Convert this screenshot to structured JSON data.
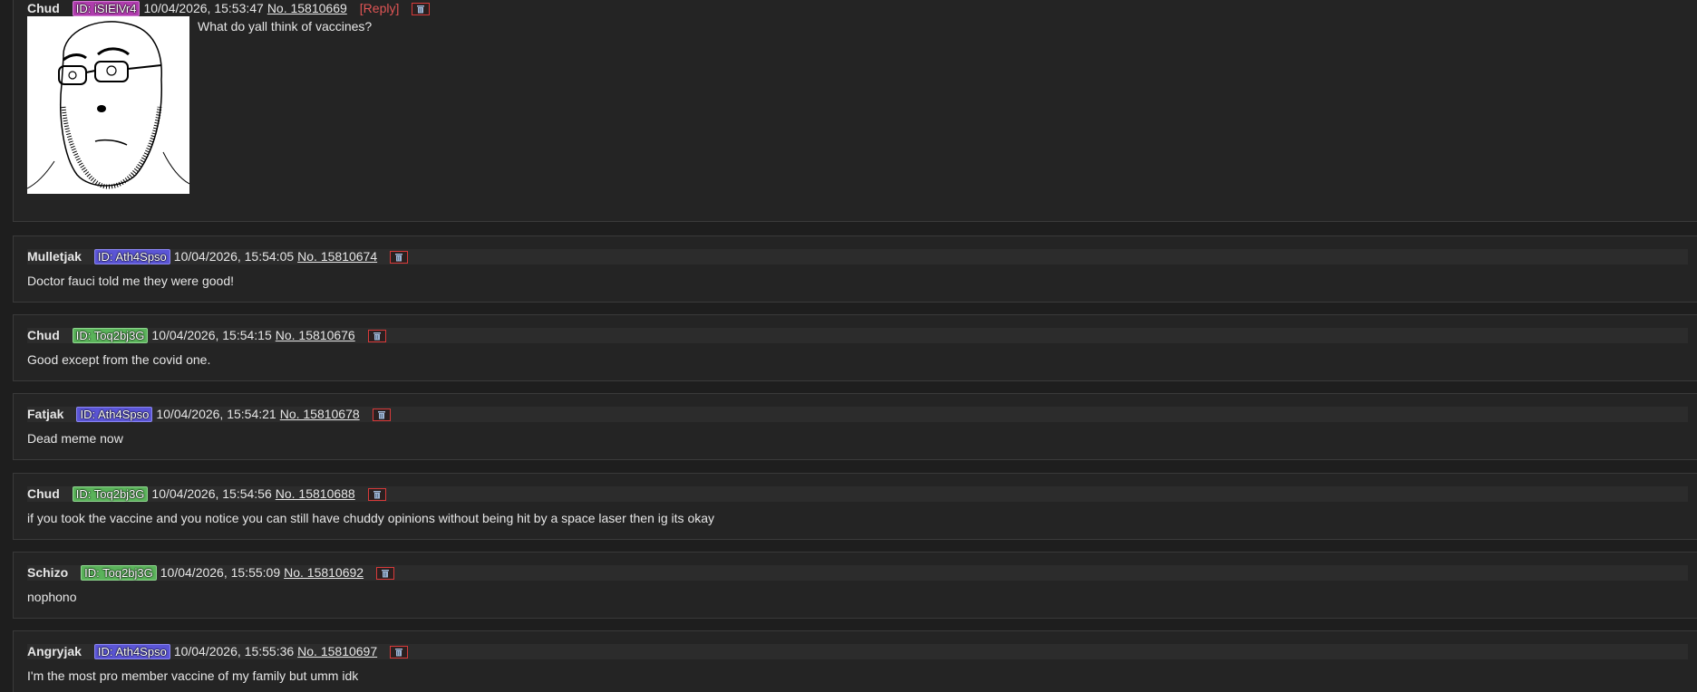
{
  "colors": {
    "background": "#1e1e1e",
    "post_background": "#242424",
    "id_purple": "#5b55d6",
    "id_green": "#5ab35a",
    "id_magenta": "#b03dae",
    "reply_link": "#e05555",
    "delete_border": "#d83a3a"
  },
  "op": {
    "name": "Chud",
    "id": "ID: iSIElVr4",
    "timestamp": "10/04/2026, 15:53:47",
    "post_no": "No. 15810669",
    "reply_label": "[Reply]",
    "delete_icon": "trash-icon",
    "image": "wojak-glasses-beard-drawing",
    "text": "What do yall think of vaccines?"
  },
  "replies": [
    {
      "name": "Mulletjak",
      "id": "ID: Ath4Spso",
      "timestamp": "10/04/2026, 15:54:05",
      "post_no": "No. 15810674",
      "text": "Doctor fauci told me they were good!"
    },
    {
      "name": "Chud",
      "id": "ID: Toq2bj3G",
      "timestamp": "10/04/2026, 15:54:15",
      "post_no": "No. 15810676",
      "text": "Good except from the covid one."
    },
    {
      "name": "Fatjak",
      "id": "ID: Ath4Spso",
      "timestamp": "10/04/2026, 15:54:21",
      "post_no": "No. 15810678",
      "text": "Dead meme now"
    },
    {
      "name": "Chud",
      "id": "ID: Toq2bj3G",
      "timestamp": "10/04/2026, 15:54:56",
      "post_no": "No. 15810688",
      "text": "if you took the vaccine and you notice you can still have chuddy opinions without being hit by a space laser then ig its okay"
    },
    {
      "name": "Schizo",
      "id": "ID: Toq2bj3G",
      "timestamp": "10/04/2026, 15:55:09",
      "post_no": "No. 15810692",
      "text": "nophono"
    },
    {
      "name": "Angryjak",
      "id": "ID: Ath4Spso",
      "timestamp": "10/04/2026, 15:55:36",
      "post_no": "No. 15810697",
      "text": "I'm the most pro member vaccine of my family but umm idk"
    }
  ]
}
